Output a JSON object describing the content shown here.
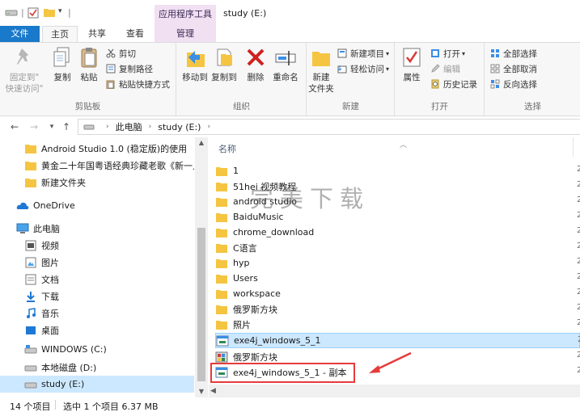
{
  "window": {
    "title": "study (E:)",
    "context_tab": "应用程序工具"
  },
  "tabs": {
    "file": "文件",
    "home": "主页",
    "share": "共享",
    "view": "查看",
    "manage": "管理"
  },
  "ribbon": {
    "clipboard": {
      "label": "剪贴板",
      "pin": "固定到\"快速访问\"",
      "pin_line1": "固定到\"",
      "pin_line2": "快速访问\"",
      "copy": "复制",
      "paste": "粘贴",
      "cut": "剪切",
      "copy_path": "复制路径",
      "paste_shortcut": "粘贴快捷方式"
    },
    "organize": {
      "label": "组织",
      "move_to": "移动到",
      "copy_to": "复制到",
      "delete": "删除",
      "rename": "重命名"
    },
    "new": {
      "label": "新建",
      "new_folder_line1": "新建",
      "new_folder_line2": "文件夹",
      "new_item": "新建项目",
      "easy_access": "轻松访问"
    },
    "open": {
      "label": "打开",
      "properties": "属性",
      "open": "打开",
      "edit": "编辑",
      "history": "历史记录"
    },
    "select": {
      "label": "选择",
      "select_all": "全部选择",
      "select_none": "全部取消",
      "invert": "反向选择"
    }
  },
  "address": {
    "crumbs": [
      "此电脑",
      "study (E:)"
    ]
  },
  "nav": {
    "items": [
      {
        "label": "Android Studio 1.0 (稳定版)的使用",
        "icon": "folder-icon"
      },
      {
        "label": "黄金二十年国粤语经典珍藏老歌《新一人",
        "icon": "folder-icon"
      },
      {
        "label": "新建文件夹",
        "icon": "folder-icon"
      },
      {
        "label": "OneDrive",
        "icon": "cloud-icon"
      },
      {
        "label": "此电脑",
        "icon": "computer-icon"
      },
      {
        "label": "视频",
        "icon": "video-icon"
      },
      {
        "label": "图片",
        "icon": "pictures-icon"
      },
      {
        "label": "文档",
        "icon": "documents-icon"
      },
      {
        "label": "下载",
        "icon": "download-icon"
      },
      {
        "label": "音乐",
        "icon": "music-icon"
      },
      {
        "label": "桌面",
        "icon": "desktop-icon"
      },
      {
        "label": "WINDOWS (C:)",
        "icon": "drive-c-icon"
      },
      {
        "label": "本地磁盘 (D:)",
        "icon": "drive-icon"
      },
      {
        "label": "study (E:)",
        "icon": "drive-icon"
      }
    ]
  },
  "files": {
    "column_name": "名称",
    "date_cut": "2",
    "items": [
      {
        "name": "1",
        "type": "folder"
      },
      {
        "name": "51hei 视频教程",
        "type": "folder"
      },
      {
        "name": "android studio",
        "type": "folder"
      },
      {
        "name": "BaiduMusic",
        "type": "folder"
      },
      {
        "name": "chrome_download",
        "type": "folder"
      },
      {
        "name": "C语言",
        "type": "folder"
      },
      {
        "name": "hyp",
        "type": "folder"
      },
      {
        "name": "Users",
        "type": "folder"
      },
      {
        "name": "workspace",
        "type": "folder"
      },
      {
        "name": "俄罗斯方块",
        "type": "folder"
      },
      {
        "name": "照片",
        "type": "folder"
      },
      {
        "name": "exe4j_windows_5_1",
        "type": "exe"
      },
      {
        "name": "俄罗斯方块",
        "type": "exe"
      },
      {
        "name": "exe4j_windows_5_1 - 副本",
        "type": "exe"
      }
    ]
  },
  "watermark": "完美下载",
  "status": {
    "count": "14 个项目",
    "selection": "选中 1 个项目  6.37 MB"
  },
  "colors": {
    "accent": "#1979ca",
    "selection": "#cce8ff",
    "context_tab": "#f1dff2",
    "highlight": "#e63b3b",
    "folder": "#f5c542"
  }
}
